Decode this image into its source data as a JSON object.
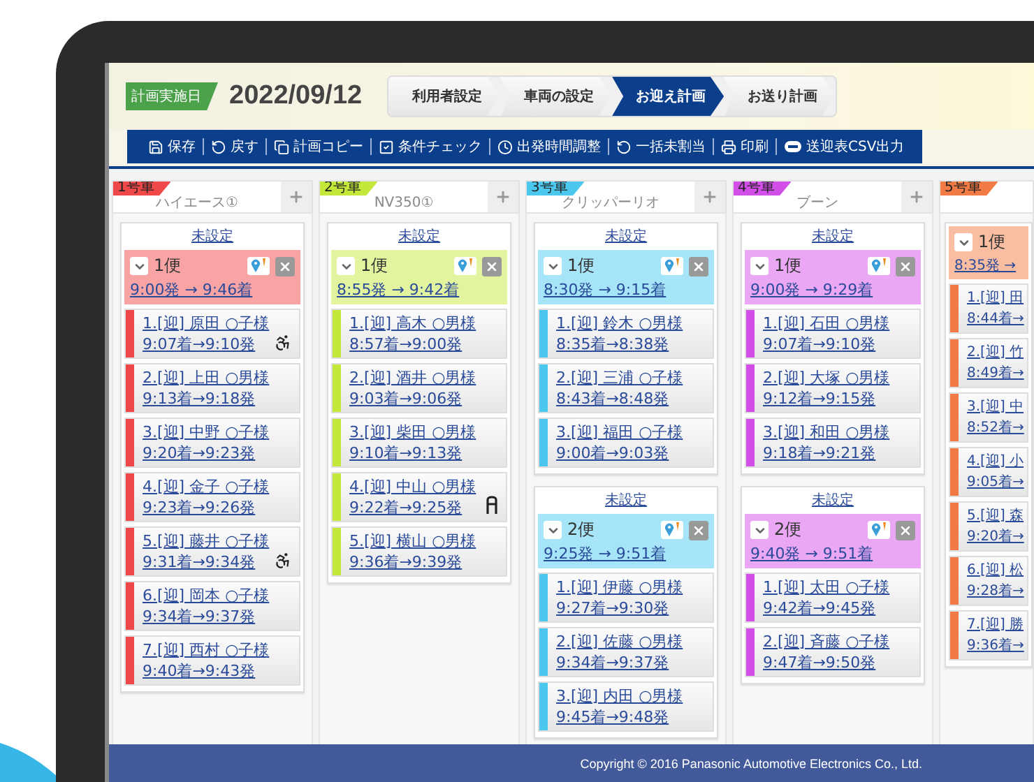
{
  "plan_date": {
    "label": "計画実施日",
    "value": "2022/09/12"
  },
  "steps": [
    {
      "label": "利用者設定",
      "selected": false
    },
    {
      "label": "車両の設定",
      "selected": false
    },
    {
      "label": "お迎え計画",
      "selected": true
    },
    {
      "label": "お送り計画",
      "selected": false
    }
  ],
  "toolbar": [
    "保存",
    "戻す",
    "計画コピー",
    "条件チェック",
    "出発時間調整",
    "一括未割当",
    "印刷",
    "送迎表CSV出力"
  ],
  "vehicles": [
    {
      "label": "1号車",
      "name": "ハイエース①",
      "color": "#f04848",
      "trips": [
        {
          "unset": "未設定",
          "number": "1便",
          "time": "9:00発 → 9:46着",
          "passengers": [
            {
              "kind": "wheelchair",
              "name": "1.[迎] 原田 ○子様",
              "time": "9:07着→9:10発"
            },
            {
              "kind": "regular",
              "name": "2.[迎] 上田 ○男様",
              "time": "9:13着→9:18発"
            },
            {
              "kind": "regular",
              "name": "3.[迎] 中野 ○子様",
              "time": "9:20着→9:23発"
            },
            {
              "kind": "regular",
              "name": "4.[迎] 金子 ○子様",
              "time": "9:23着→9:26発"
            },
            {
              "kind": "wheelchair",
              "name": "5.[迎] 藤井 ○子様",
              "time": "9:31着→9:34発"
            },
            {
              "kind": "regular",
              "name": "6.[迎] 岡本 ○子様",
              "time": "9:34着→9:37発"
            },
            {
              "kind": "regular",
              "name": "7.[迎] 西村 ○子様",
              "time": "9:40着→9:43発"
            }
          ]
        }
      ]
    },
    {
      "label": "2号車",
      "name": "NV350①",
      "color": "#c4e83a",
      "trips": [
        {
          "unset": "未設定",
          "number": "1便",
          "time": "8:55発 → 9:42着",
          "passengers": [
            {
              "kind": "regular",
              "name": "1.[迎] 高木 ○男様",
              "time": "8:57着→9:00発"
            },
            {
              "kind": "regular",
              "name": "2.[迎] 酒井 ○男様",
              "time": "9:03着→9:06発"
            },
            {
              "kind": "regular",
              "name": "3.[迎] 柴田 ○男様",
              "time": "9:10着→9:13発"
            },
            {
              "kind": "walker",
              "name": "4.[迎] 中山 ○男様",
              "time": "9:22着→9:25発"
            },
            {
              "kind": "regular",
              "name": "5.[迎] 横山 ○男様",
              "time": "9:36着→9:39発"
            }
          ]
        }
      ]
    },
    {
      "label": "3号車",
      "name": "クリッパーリオ",
      "color": "#4cc8ee",
      "trips": [
        {
          "unset": "未設定",
          "number": "1便",
          "time": "8:30発 → 9:15着",
          "passengers": [
            {
              "name": "1.[迎] 鈴木 ○男様",
              "time": "8:35着→8:38発"
            },
            {
              "name": "2.[迎] 三浦 ○子様",
              "time": "8:43着→8:48発"
            },
            {
              "name": "3.[迎] 福田 ○子様",
              "time": "9:00着→9:03発"
            }
          ]
        },
        {
          "unset": "未設定",
          "number": "2便",
          "time": "9:25発 → 9:51着",
          "passengers": [
            {
              "name": "1.[迎] 伊藤 ○男様",
              "time": "9:27着→9:30発"
            },
            {
              "name": "2.[迎] 佐藤 ○男様",
              "time": "9:34着→9:37発"
            },
            {
              "name": "3.[迎] 内田 ○男様",
              "time": "9:45着→9:48発"
            }
          ]
        }
      ]
    },
    {
      "label": "4号車",
      "name": "ブーン",
      "color": "#d24ee8",
      "trips": [
        {
          "unset": "未設定",
          "number": "1便",
          "time": "9:00発 → 9:29着",
          "passengers": [
            {
              "name": "1.[迎] 石田 ○男様",
              "time": "9:07着→9:10発"
            },
            {
              "name": "2.[迎] 大塚 ○男様",
              "time": "9:12着→9:15発"
            },
            {
              "name": "3.[迎] 和田 ○男様",
              "time": "9:18着→9:21発"
            }
          ]
        },
        {
          "unset": "未設定",
          "number": "2便",
          "time": "9:40発 → 9:51着",
          "passengers": [
            {
              "name": "1.[迎] 太田 ○子様",
              "time": "9:42着→9:45発"
            },
            {
              "name": "2.[迎] 斉藤 ○子様",
              "time": "9:47着→9:50発"
            }
          ]
        }
      ]
    },
    {
      "label": "5号車",
      "color": "#f27a44",
      "trips": [
        {
          "number": "1便",
          "time": "8:35発 →",
          "passengers": [
            {
              "name": "1.[迎] 田",
              "time": "8:44着→"
            },
            {
              "name": "2.[迎] 竹",
              "time": "8:49着→"
            },
            {
              "name": "3.[迎] 中",
              "time": "8:52着→"
            },
            {
              "name": "4.[迎] 小",
              "time": "9:05着→"
            },
            {
              "name": "5.[迎] 森",
              "time": "9:20着→"
            },
            {
              "name": "6.[迎] 松",
              "time": "9:28着→"
            },
            {
              "name": "7.[迎] 勝",
              "time": "9:36着→"
            }
          ]
        }
      ]
    }
  ],
  "footer": "Copyright © 2016 Panasonic Automotive Electronics Co., Ltd."
}
